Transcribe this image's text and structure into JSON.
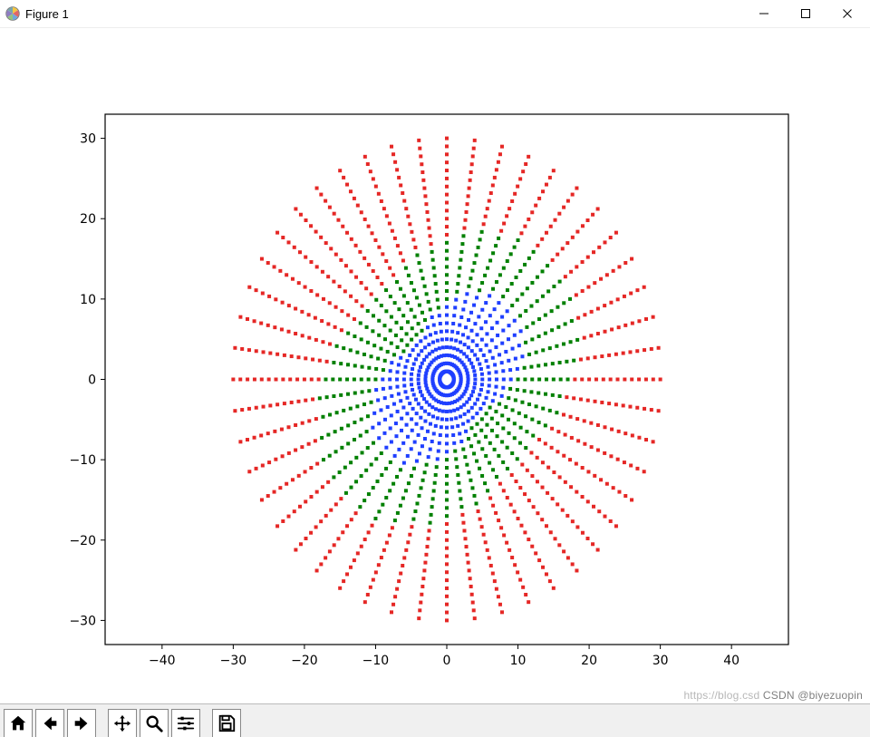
{
  "window": {
    "title": "Figure 1"
  },
  "toolbar": {
    "home": "Home",
    "back": "Back",
    "forward": "Forward",
    "pan": "Pan",
    "zoom": "Zoom",
    "config": "Configure",
    "save": "Save"
  },
  "watermark": {
    "faint": "https://blog.csd",
    "dark": "CSDN @biyezuopin"
  },
  "chart_data": {
    "type": "scatter",
    "title": "",
    "xlabel": "",
    "ylabel": "",
    "xlim": [
      -48,
      48
    ],
    "ylim": [
      -33,
      33
    ],
    "xticks": [
      -40,
      -30,
      -20,
      -10,
      0,
      10,
      20,
      30,
      40
    ],
    "yticks": [
      -30,
      -20,
      -10,
      0,
      10,
      20,
      30
    ],
    "description": "Radial dotted starburst. 48 rays of 30 dots each at radii 1..30. Color per point by radius+ray-offset: 0–9 blue, 10–17 green, 18–30 red.",
    "colors": {
      "blue": "#1f3fff",
      "green": "#008000",
      "red": "#e52725"
    },
    "generator": {
      "num_rays": 48,
      "num_radii": 30,
      "radius_step": 1,
      "ray_offset_period": 24,
      "ray_offset_amplitude": 3,
      "color_bands": [
        {
          "max": 10,
          "color": "blue"
        },
        {
          "max": 18,
          "color": "green"
        },
        {
          "max": 31,
          "color": "red"
        }
      ]
    }
  }
}
